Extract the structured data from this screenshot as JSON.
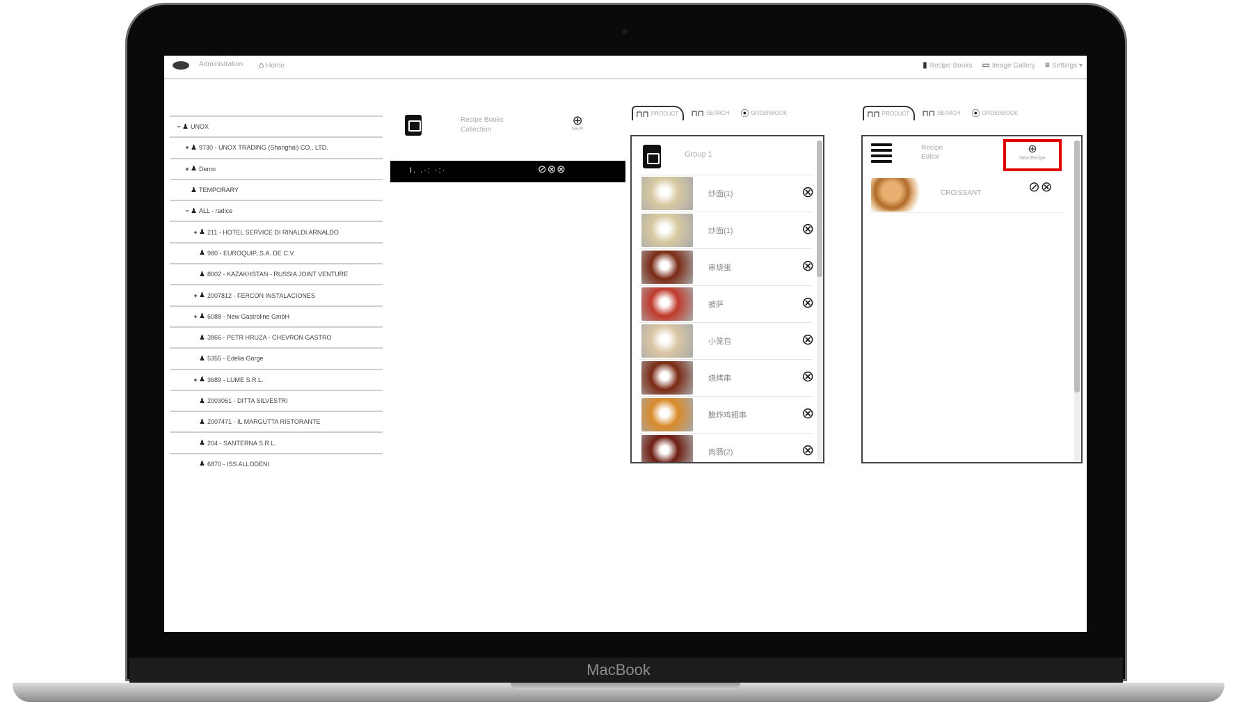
{
  "device": {
    "brand": "MacBook"
  },
  "nav": {
    "section": "Administration",
    "home": "Home",
    "recipe_books": "Recipe Books",
    "image_gallery": "Image Gallery",
    "settings": "Settings"
  },
  "tree": [
    {
      "sign": "−",
      "label": "UNOX",
      "indent": 0
    },
    {
      "sign": "+",
      "label": "9730 - UNOX TRADING (Shanghai) CO., LTD.",
      "indent": 1
    },
    {
      "sign": "+",
      "label": "Demo",
      "indent": 1
    },
    {
      "sign": "",
      "label": "TEMPORARY",
      "indent": 1
    },
    {
      "sign": "−",
      "label": "ALL - radice",
      "indent": 1
    },
    {
      "sign": "+",
      "label": "211 - HOTEL SERVICE DI RINALDI ARNALDO",
      "indent": 2
    },
    {
      "sign": "",
      "label": "980 - EUROQUIP, S.A. DE C.V.",
      "indent": 2
    },
    {
      "sign": "",
      "label": "8002 - KAZAKHSTAN - RUSSIA JOINT VENTURE",
      "indent": 2
    },
    {
      "sign": "+",
      "label": "2007812 - FERCON INSTALACIONES",
      "indent": 2
    },
    {
      "sign": "+",
      "label": "6088 - New Gastroline GmbH",
      "indent": 2
    },
    {
      "sign": "",
      "label": "3866 - PETR HRUZA - CHEVRON GASTRO",
      "indent": 2
    },
    {
      "sign": "",
      "label": "5355 - Edelia Gorge",
      "indent": 2
    },
    {
      "sign": "+",
      "label": "3689 - LUME S.R.L.",
      "indent": 2
    },
    {
      "sign": "",
      "label": "2003061 - DITTA SILVESTRI",
      "indent": 2
    },
    {
      "sign": "",
      "label": "2007471 - IL MARGUTTA RISTORANTE",
      "indent": 2
    },
    {
      "sign": "",
      "label": "204 - SANTERNA S.R.L.",
      "indent": 2
    },
    {
      "sign": "",
      "label": "6870 - ISS ALLODENI",
      "indent": 2
    }
  ],
  "collection": {
    "title": "Recipe Books Collection",
    "new_label": "NEW",
    "selected_label": "I. .·: ·:·",
    "selected_actions": "⊘⊗⊗"
  },
  "panel_groups": {
    "tabs": [
      "PRODUCT",
      "SEARCH",
      "ORDERBOOK"
    ],
    "group_name": "Group 1",
    "recipes": [
      {
        "name": "炒面(1)",
        "thumb": "noodles"
      },
      {
        "name": "炒面(1)",
        "thumb": "noodles"
      },
      {
        "name": "串烧蛋",
        "thumb": "skewers"
      },
      {
        "name": "披萨",
        "thumb": "pizza"
      },
      {
        "name": "小笼包",
        "thumb": "dumplings"
      },
      {
        "name": "烧烤串",
        "thumb": "skewers"
      },
      {
        "name": "脆炸鸡翅串",
        "thumb": "fried"
      },
      {
        "name": "肉肠(2)",
        "thumb": "sausage"
      }
    ],
    "remove_icon": "⊗"
  },
  "panel_recipes": {
    "tabs": [
      "PRODUCT",
      "SEARCH",
      "ORDERBOOK"
    ],
    "title": "Recipe Editor",
    "new_label": "New Recipe",
    "items": [
      {
        "name": "CROISSANT"
      }
    ],
    "actions": "⊘⊗"
  },
  "thumb_colors": {
    "noodles": "#d7c9a1",
    "skewers": "#7a2a14",
    "pizza": "#c0392b",
    "dumplings": "#d9c6a5",
    "fried": "#d98a2a",
    "sausage": "#6e1d12"
  }
}
